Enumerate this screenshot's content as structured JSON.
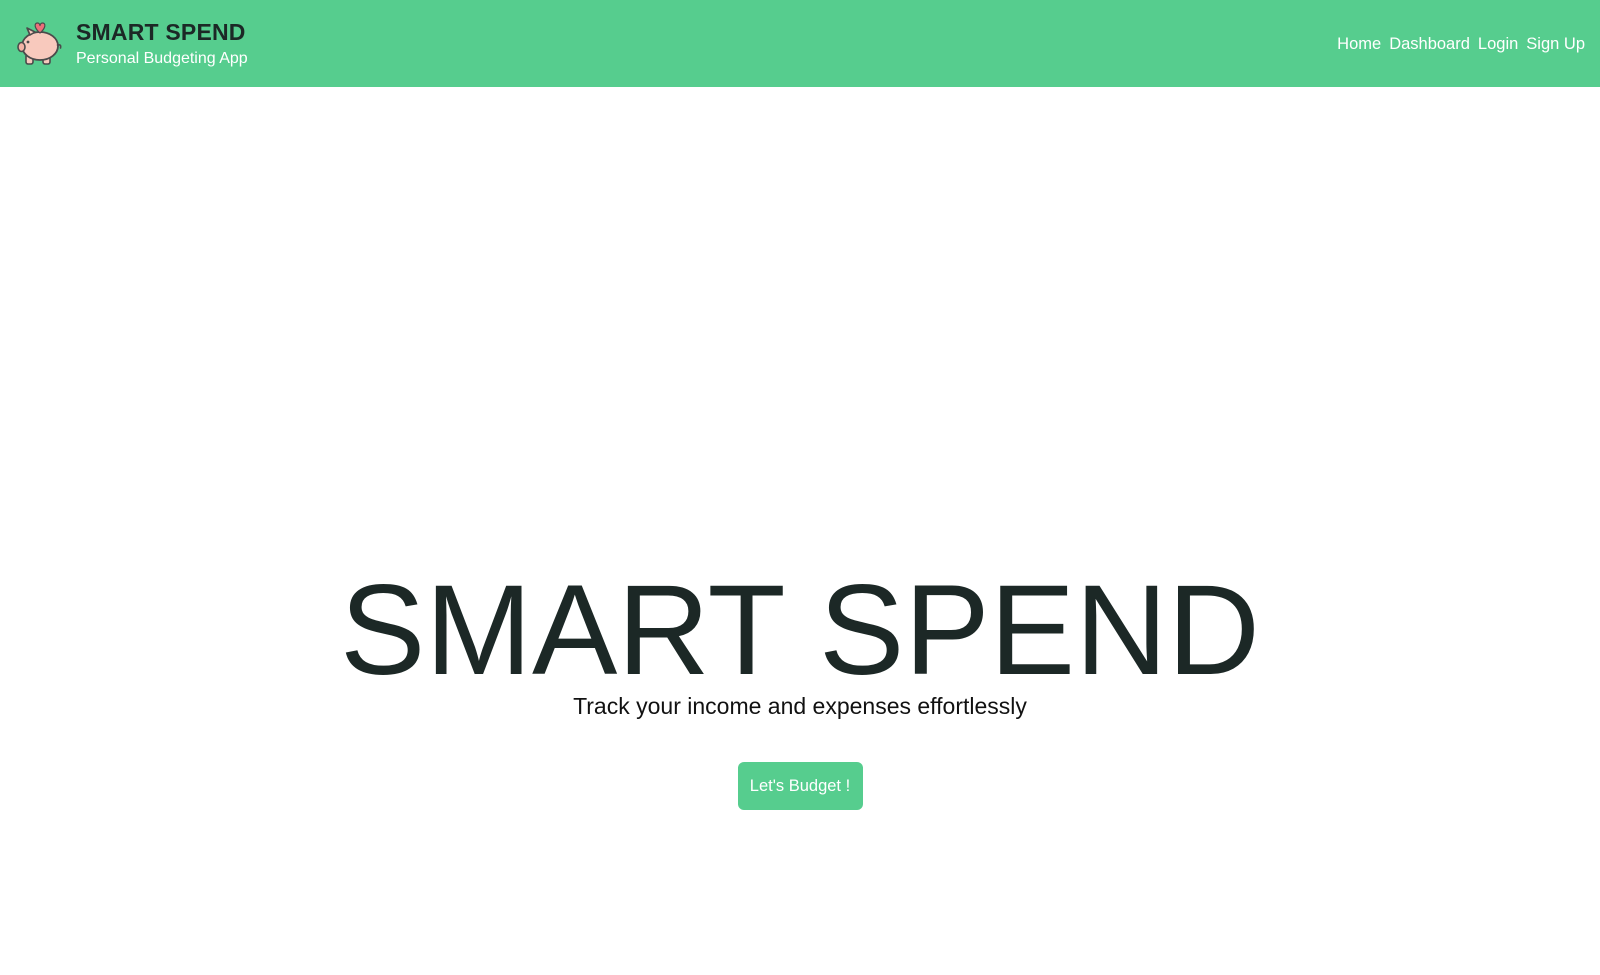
{
  "navbar": {
    "logo_icon": "piggy-bank-icon",
    "title": "SMART SPEND",
    "subtitle": "Personal Budgeting App",
    "links": [
      "Home",
      "Dashboard",
      "Login",
      "Sign Up"
    ]
  },
  "hero": {
    "title": "SMART SPEND",
    "subtitle": "Track your income and expenses effortlessly",
    "cta_label": "Let's Budget !"
  },
  "colors": {
    "accent": "#56cd8e",
    "text_dark": "#1c2826",
    "piggy": "#f8c9bd",
    "heart": "#ec6f7a"
  }
}
